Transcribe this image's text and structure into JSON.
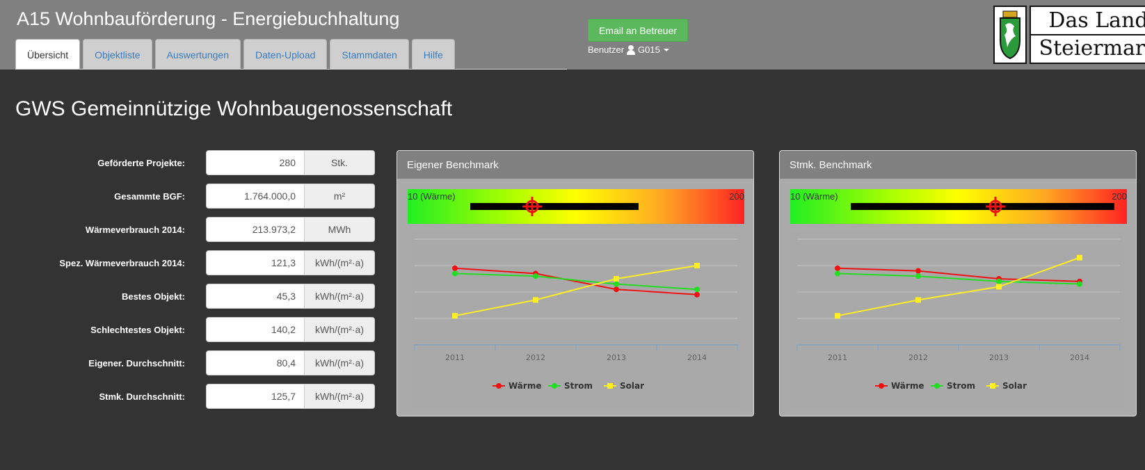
{
  "header": {
    "title": "A15 Wohnbauförderung - Energiebuchhaltung",
    "tabs": [
      {
        "label": "Übersicht",
        "active": true
      },
      {
        "label": "Objektliste"
      },
      {
        "label": "Auswertungen"
      },
      {
        "label": "Daten-Upload"
      },
      {
        "label": "Stammdaten"
      },
      {
        "label": "Hilfe"
      }
    ],
    "email_button": "Email an Betreuer",
    "user_label": "Benutzer",
    "user_id": "G015",
    "logo": {
      "line1": "Das Land",
      "line2": "Steiermark"
    }
  },
  "page_title": "GWS Gemeinnützige Wohnbaugenossenschaft",
  "stats": [
    {
      "label": "Geförderte Projekte:",
      "value": "280",
      "unit": "Stk."
    },
    {
      "label": "Gesammte BGF:",
      "value": "1.764.000,0",
      "unit": "m²"
    },
    {
      "label": "Wärmeverbrauch 2014:",
      "value": "213.973,2",
      "unit": "MWh"
    },
    {
      "label": "Spez. Wärmeverbrauch 2014:",
      "value": "121,3",
      "unit": "kWh/(m²·a)"
    },
    {
      "label": "Bestes Objekt:",
      "value": "45,3",
      "unit": "kWh/(m²·a)"
    },
    {
      "label": "Schlechtestes Objekt:",
      "value": "140,2",
      "unit": "kWh/(m²·a)"
    },
    {
      "label": "Eigener. Durchschnitt:",
      "value": "80,4",
      "unit": "kWh/(m²·a)"
    },
    {
      "label": "Stmk. Durchschnitt:",
      "value": "125,7",
      "unit": "kWh/(m²·a)"
    }
  ],
  "panels": [
    {
      "title": "Eigener Benchmark",
      "benchmark": {
        "min_label": "10 (Wärme)",
        "max_label": "200",
        "min": 10,
        "max": 200,
        "range_low": 45.3,
        "range_high": 140.2,
        "marker": 80.4
      }
    },
    {
      "title": "Stmk. Benchmark",
      "benchmark": {
        "min_label": "10 (Wärme)",
        "max_label": "200",
        "min": 10,
        "max": 200,
        "range_low": 44,
        "range_high": 193,
        "marker": 125.7
      }
    }
  ],
  "chart_data": [
    {
      "type": "line",
      "x": [
        "2011",
        "2012",
        "2013",
        "2014"
      ],
      "ylim": [
        0,
        4
      ],
      "grid": true,
      "legend": "bottom",
      "series": [
        {
          "name": "Wärme",
          "color": "#ee1111",
          "marker": "circle",
          "values": [
            2.9,
            2.7,
            2.1,
            1.9
          ]
        },
        {
          "name": "Strom",
          "color": "#22dd22",
          "marker": "circle",
          "values": [
            2.7,
            2.6,
            2.3,
            2.1
          ]
        },
        {
          "name": "Solar",
          "color": "#ffee22",
          "marker": "square",
          "values": [
            1.1,
            1.7,
            2.5,
            3.0
          ]
        }
      ]
    },
    {
      "type": "line",
      "x": [
        "2011",
        "2012",
        "2013",
        "2014"
      ],
      "ylim": [
        0,
        4
      ],
      "grid": true,
      "legend": "bottom",
      "series": [
        {
          "name": "Wärme",
          "color": "#ee1111",
          "marker": "circle",
          "values": [
            2.9,
            2.8,
            2.5,
            2.4
          ]
        },
        {
          "name": "Strom",
          "color": "#22dd22",
          "marker": "circle",
          "values": [
            2.7,
            2.6,
            2.4,
            2.3
          ]
        },
        {
          "name": "Solar",
          "color": "#ffee22",
          "marker": "square",
          "values": [
            1.1,
            1.7,
            2.2,
            3.3
          ]
        }
      ]
    }
  ]
}
